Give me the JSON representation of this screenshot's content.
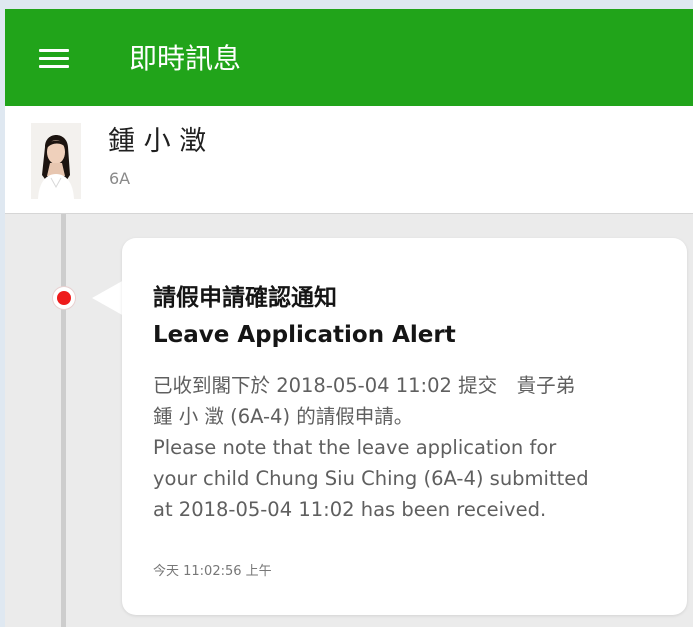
{
  "header": {
    "title": "即時訊息",
    "menu_icon": "hamburger-menu-icon",
    "background": "#21a41a"
  },
  "profile": {
    "name": "鍾 小 澂",
    "class_label": "6A",
    "avatar": "student-photo"
  },
  "message": {
    "title_zh": "請假申請確認通知",
    "title_en": "Leave Application Alert",
    "body_lines": [
      "已收到閣下於 2018-05-04 11:02 提交　貴子弟",
      "鍾 小 澂 (6A-4) 的請假申請。",
      "Please note that the leave application for",
      "your child Chung Siu Ching (6A-4) submitted",
      "at 2018-05-04 11:02 has been received."
    ],
    "timestamp": "今天 11:02:56 上午",
    "status_color": "#ee1b1b"
  }
}
